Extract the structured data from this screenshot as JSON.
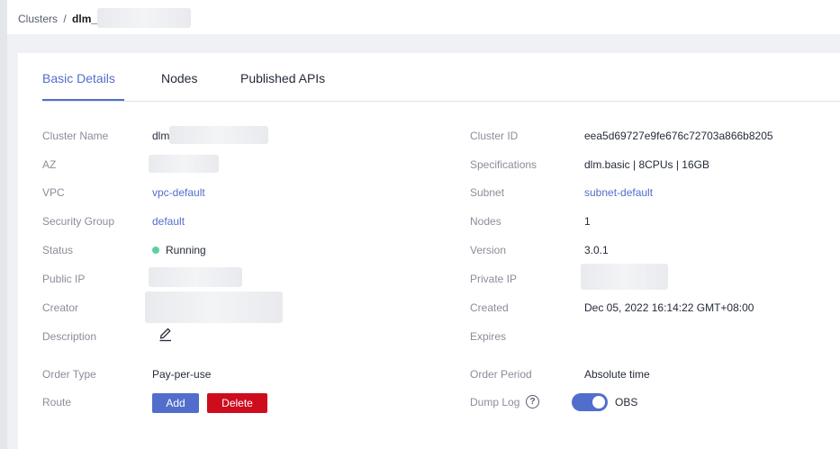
{
  "breadcrumb": {
    "root": "Clusters",
    "sep": "/",
    "current": "dlm_"
  },
  "tabs": [
    {
      "label": "Basic Details",
      "active": true
    },
    {
      "label": "Nodes",
      "active": false
    },
    {
      "label": "Published APIs",
      "active": false
    }
  ],
  "details": {
    "cluster_name": {
      "label": "Cluster Name",
      "value": "dlm"
    },
    "az": {
      "label": "AZ"
    },
    "vpc": {
      "label": "VPC",
      "value": "vpc-default"
    },
    "security_group": {
      "label": "Security Group",
      "value": "default"
    },
    "status": {
      "label": "Status",
      "value": "Running"
    },
    "public_ip": {
      "label": "Public IP"
    },
    "creator": {
      "label": "Creator"
    },
    "description": {
      "label": "Description"
    },
    "order_type": {
      "label": "Order Type",
      "value": "Pay-per-use"
    },
    "route": {
      "label": "Route",
      "add_label": "Add",
      "delete_label": "Delete"
    },
    "cluster_id": {
      "label": "Cluster ID",
      "value": "eea5d69727e9fe676c72703a866b8205"
    },
    "specifications": {
      "label": "Specifications",
      "value": "dlm.basic | 8CPUs | 16GB"
    },
    "subnet": {
      "label": "Subnet",
      "value": "subnet-default"
    },
    "nodes": {
      "label": "Nodes",
      "value": "1"
    },
    "version": {
      "label": "Version",
      "value": "3.0.1"
    },
    "private_ip": {
      "label": "Private IP"
    },
    "created": {
      "label": "Created",
      "value": "Dec 05, 2022 16:14:22 GMT+08:00"
    },
    "expires": {
      "label": "Expires"
    },
    "order_period": {
      "label": "Order Period",
      "value": "Absolute time"
    },
    "dump_log": {
      "label": "Dump Log",
      "help_glyph": "?",
      "toggle_on": true,
      "toggle_label": "OBS"
    }
  },
  "colors": {
    "accent": "#526ecc",
    "danger": "#cd0d1d",
    "running": "#5ed09e",
    "label": "#8a8e99"
  },
  "icons": {
    "edit": "pencil-icon",
    "help": "question-circle-icon"
  }
}
